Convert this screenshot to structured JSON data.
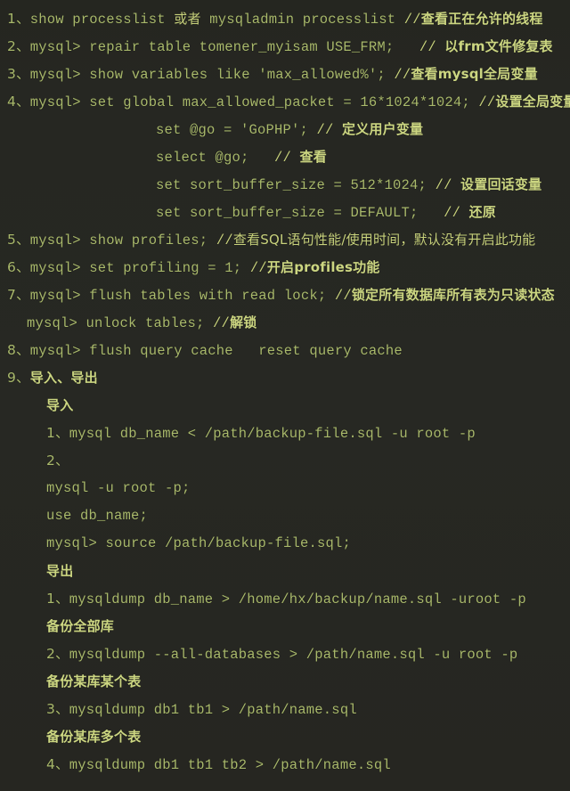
{
  "document": {
    "kind": "code-notes",
    "language": "sql-shell",
    "background_color": "#262722",
    "code_color": "#a9b96b",
    "comment_color": "#c8d27c",
    "comment_bold_color": "#ccd681",
    "line_count": 28
  },
  "lines": [
    {
      "id": 1,
      "indent": 0,
      "segments": [
        {
          "kind": "num",
          "text": "1、"
        },
        {
          "kind": "cmd",
          "text": "show processlist "
        },
        {
          "kind": "cn",
          "text": "或者"
        },
        {
          "kind": "cmd",
          "text": " mysqladmin processlist "
        },
        {
          "kind": "cmt",
          "text": "//"
        },
        {
          "kind": "cn-b",
          "text": "查看正在允许的线程"
        }
      ]
    },
    {
      "id": 2,
      "indent": 0,
      "segments": [
        {
          "kind": "num",
          "text": "2、"
        },
        {
          "kind": "cmd",
          "text": "mysql> repair table tomener_myisam USE_FRM;   "
        },
        {
          "kind": "cmt",
          "text": "// "
        },
        {
          "kind": "cn-b",
          "text": "以frm文件修复表"
        }
      ]
    },
    {
      "id": 3,
      "indent": 0,
      "segments": [
        {
          "kind": "num",
          "text": "3、"
        },
        {
          "kind": "cmd",
          "text": "mysql> show variables like 'max_allowed%'; "
        },
        {
          "kind": "cmt",
          "text": "//"
        },
        {
          "kind": "cn-b",
          "text": "查看mysql全局变量"
        }
      ]
    },
    {
      "id": 4,
      "indent": 0,
      "segments": [
        {
          "kind": "num",
          "text": "4、"
        },
        {
          "kind": "cmd",
          "text": "mysql> set global max_allowed_packet = 16*1024*1024; "
        },
        {
          "kind": "cmt",
          "text": "//"
        },
        {
          "kind": "cn-b",
          "text": "设置全局变量"
        }
      ]
    },
    {
      "id": 5,
      "indent": 5,
      "segments": [
        {
          "kind": "cmd",
          "text": "set @go = 'GoPHP'; "
        },
        {
          "kind": "cmt",
          "text": "// "
        },
        {
          "kind": "cn-b",
          "text": "定义用户变量"
        }
      ]
    },
    {
      "id": 6,
      "indent": 5,
      "segments": [
        {
          "kind": "cmd",
          "text": "select @go;   "
        },
        {
          "kind": "cmt",
          "text": "// "
        },
        {
          "kind": "cn-b",
          "text": "查看"
        }
      ]
    },
    {
      "id": 7,
      "indent": 5,
      "segments": [
        {
          "kind": "cmd",
          "text": "set sort_buffer_size = 512*1024; "
        },
        {
          "kind": "cmt",
          "text": "// "
        },
        {
          "kind": "cn-b",
          "text": "设置回话变量"
        }
      ]
    },
    {
      "id": 8,
      "indent": 5,
      "segments": [
        {
          "kind": "cmd",
          "text": "set sort_buffer_size = DEFAULT;   "
        },
        {
          "kind": "cmt",
          "text": "// "
        },
        {
          "kind": "cn-b",
          "text": "还原"
        }
      ]
    },
    {
      "id": 9,
      "indent": 0,
      "segments": [
        {
          "kind": "num",
          "text": "5、"
        },
        {
          "kind": "cmd",
          "text": "mysql> show profiles; "
        },
        {
          "kind": "cmt",
          "text": "//"
        },
        {
          "kind": "cn",
          "text": "查看SQL语句性能/使用时间，默认没有开启此功能"
        }
      ]
    },
    {
      "id": 10,
      "indent": 0,
      "segments": [
        {
          "kind": "num",
          "text": "6、"
        },
        {
          "kind": "cmd",
          "text": "mysql> set profiling = 1; "
        },
        {
          "kind": "cmt",
          "text": "//"
        },
        {
          "kind": "cn-b",
          "text": "开启profiles功能"
        }
      ]
    },
    {
      "id": 11,
      "indent": 0,
      "segments": [
        {
          "kind": "num",
          "text": "7、"
        },
        {
          "kind": "cmd",
          "text": "mysql> flush tables with read lock; "
        },
        {
          "kind": "cmt",
          "text": "//"
        },
        {
          "kind": "cn-b",
          "text": "锁定所有数据库所有表为只读状态"
        }
      ]
    },
    {
      "id": 12,
      "indent": 1,
      "segments": [
        {
          "kind": "cmd",
          "text": "mysql> unlock tables; "
        },
        {
          "kind": "cmt",
          "text": "//"
        },
        {
          "kind": "cn-b",
          "text": "解锁"
        }
      ]
    },
    {
      "id": 13,
      "indent": 0,
      "segments": [
        {
          "kind": "num",
          "text": "8、"
        },
        {
          "kind": "cmd",
          "text": "mysql> flush query cache   reset query cache"
        }
      ]
    },
    {
      "id": 14,
      "indent": 0,
      "segments": [
        {
          "kind": "num",
          "text": "9、"
        },
        {
          "kind": "cn-b",
          "text": "导入、导出"
        }
      ]
    },
    {
      "id": 15,
      "indent": 2,
      "segments": [
        {
          "kind": "cn-b",
          "text": "导入"
        }
      ]
    },
    {
      "id": 16,
      "indent": 2,
      "segments": [
        {
          "kind": "num",
          "text": "1、"
        },
        {
          "kind": "cmd",
          "text": "mysql db_name < /path/backup-file.sql -u root -p"
        }
      ]
    },
    {
      "id": 17,
      "indent": 2,
      "segments": [
        {
          "kind": "num",
          "text": "2、"
        }
      ]
    },
    {
      "id": 18,
      "indent": 2,
      "segments": [
        {
          "kind": "cmd",
          "text": "mysql -u root -p;"
        }
      ]
    },
    {
      "id": 19,
      "indent": 2,
      "segments": [
        {
          "kind": "cmd",
          "text": "use db_name;"
        }
      ]
    },
    {
      "id": 20,
      "indent": 2,
      "segments": [
        {
          "kind": "cmd",
          "text": "mysql> source /path/backup-file.sql;"
        }
      ]
    },
    {
      "id": 21,
      "indent": 2,
      "segments": [
        {
          "kind": "cn-b",
          "text": "导出"
        }
      ]
    },
    {
      "id": 22,
      "indent": 2,
      "segments": [
        {
          "kind": "num",
          "text": "1、"
        },
        {
          "kind": "cmd",
          "text": "mysqldump db_name > /home/hx/backup/name.sql -uroot -p"
        }
      ]
    },
    {
      "id": 23,
      "indent": 2,
      "segments": [
        {
          "kind": "cn-b",
          "text": "备份全部库"
        }
      ]
    },
    {
      "id": 24,
      "indent": 2,
      "segments": [
        {
          "kind": "num",
          "text": "2、"
        },
        {
          "kind": "cmd",
          "text": "mysqldump --all-databases > /path/name.sql -u root -p"
        }
      ]
    },
    {
      "id": 25,
      "indent": 2,
      "segments": [
        {
          "kind": "cn-b",
          "text": "备份某库某个表"
        }
      ]
    },
    {
      "id": 26,
      "indent": 2,
      "segments": [
        {
          "kind": "num",
          "text": "3、"
        },
        {
          "kind": "cmd",
          "text": "mysqldump db1 tb1 > /path/name.sql"
        }
      ]
    },
    {
      "id": 27,
      "indent": 2,
      "segments": [
        {
          "kind": "cn-b",
          "text": "备份某库多个表"
        }
      ]
    },
    {
      "id": 28,
      "indent": 2,
      "segments": [
        {
          "kind": "num",
          "text": "4、"
        },
        {
          "kind": "cmd",
          "text": "mysqldump db1 tb1 tb2 > /path/name.sql"
        }
      ]
    }
  ]
}
